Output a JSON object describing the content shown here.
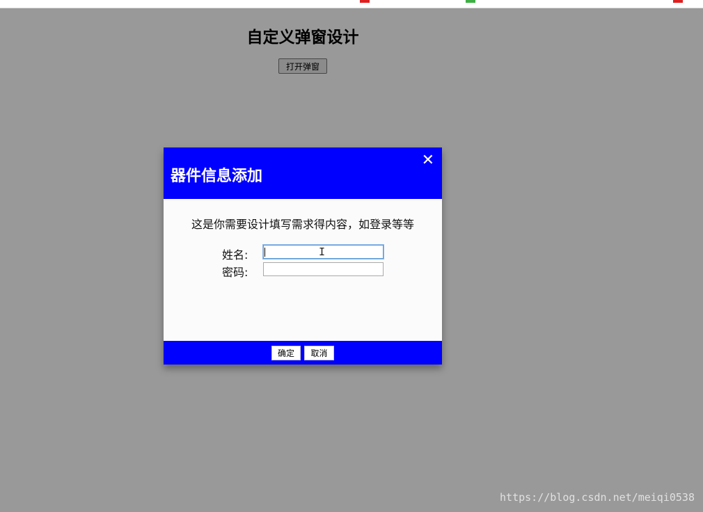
{
  "page": {
    "title": "自定义弹窗设计",
    "open_button_label": "打开弹窗"
  },
  "modal": {
    "title": "器件信息添加",
    "close_glyph": "✕",
    "description": "这是你需要设计填写需求得内容，如登录等等",
    "fields": [
      {
        "label": "姓名:",
        "value": "",
        "focused": true
      },
      {
        "label": "密码:",
        "value": "",
        "focused": false
      }
    ],
    "confirm_label": "确定",
    "cancel_label": "取消"
  },
  "watermark": "https://blog.csdn.net/meiqi0538",
  "colors": {
    "accent": "#0000ff",
    "overlay": "rgba(0,0,0,0.4)",
    "modal_body": "#fbfbfb"
  }
}
